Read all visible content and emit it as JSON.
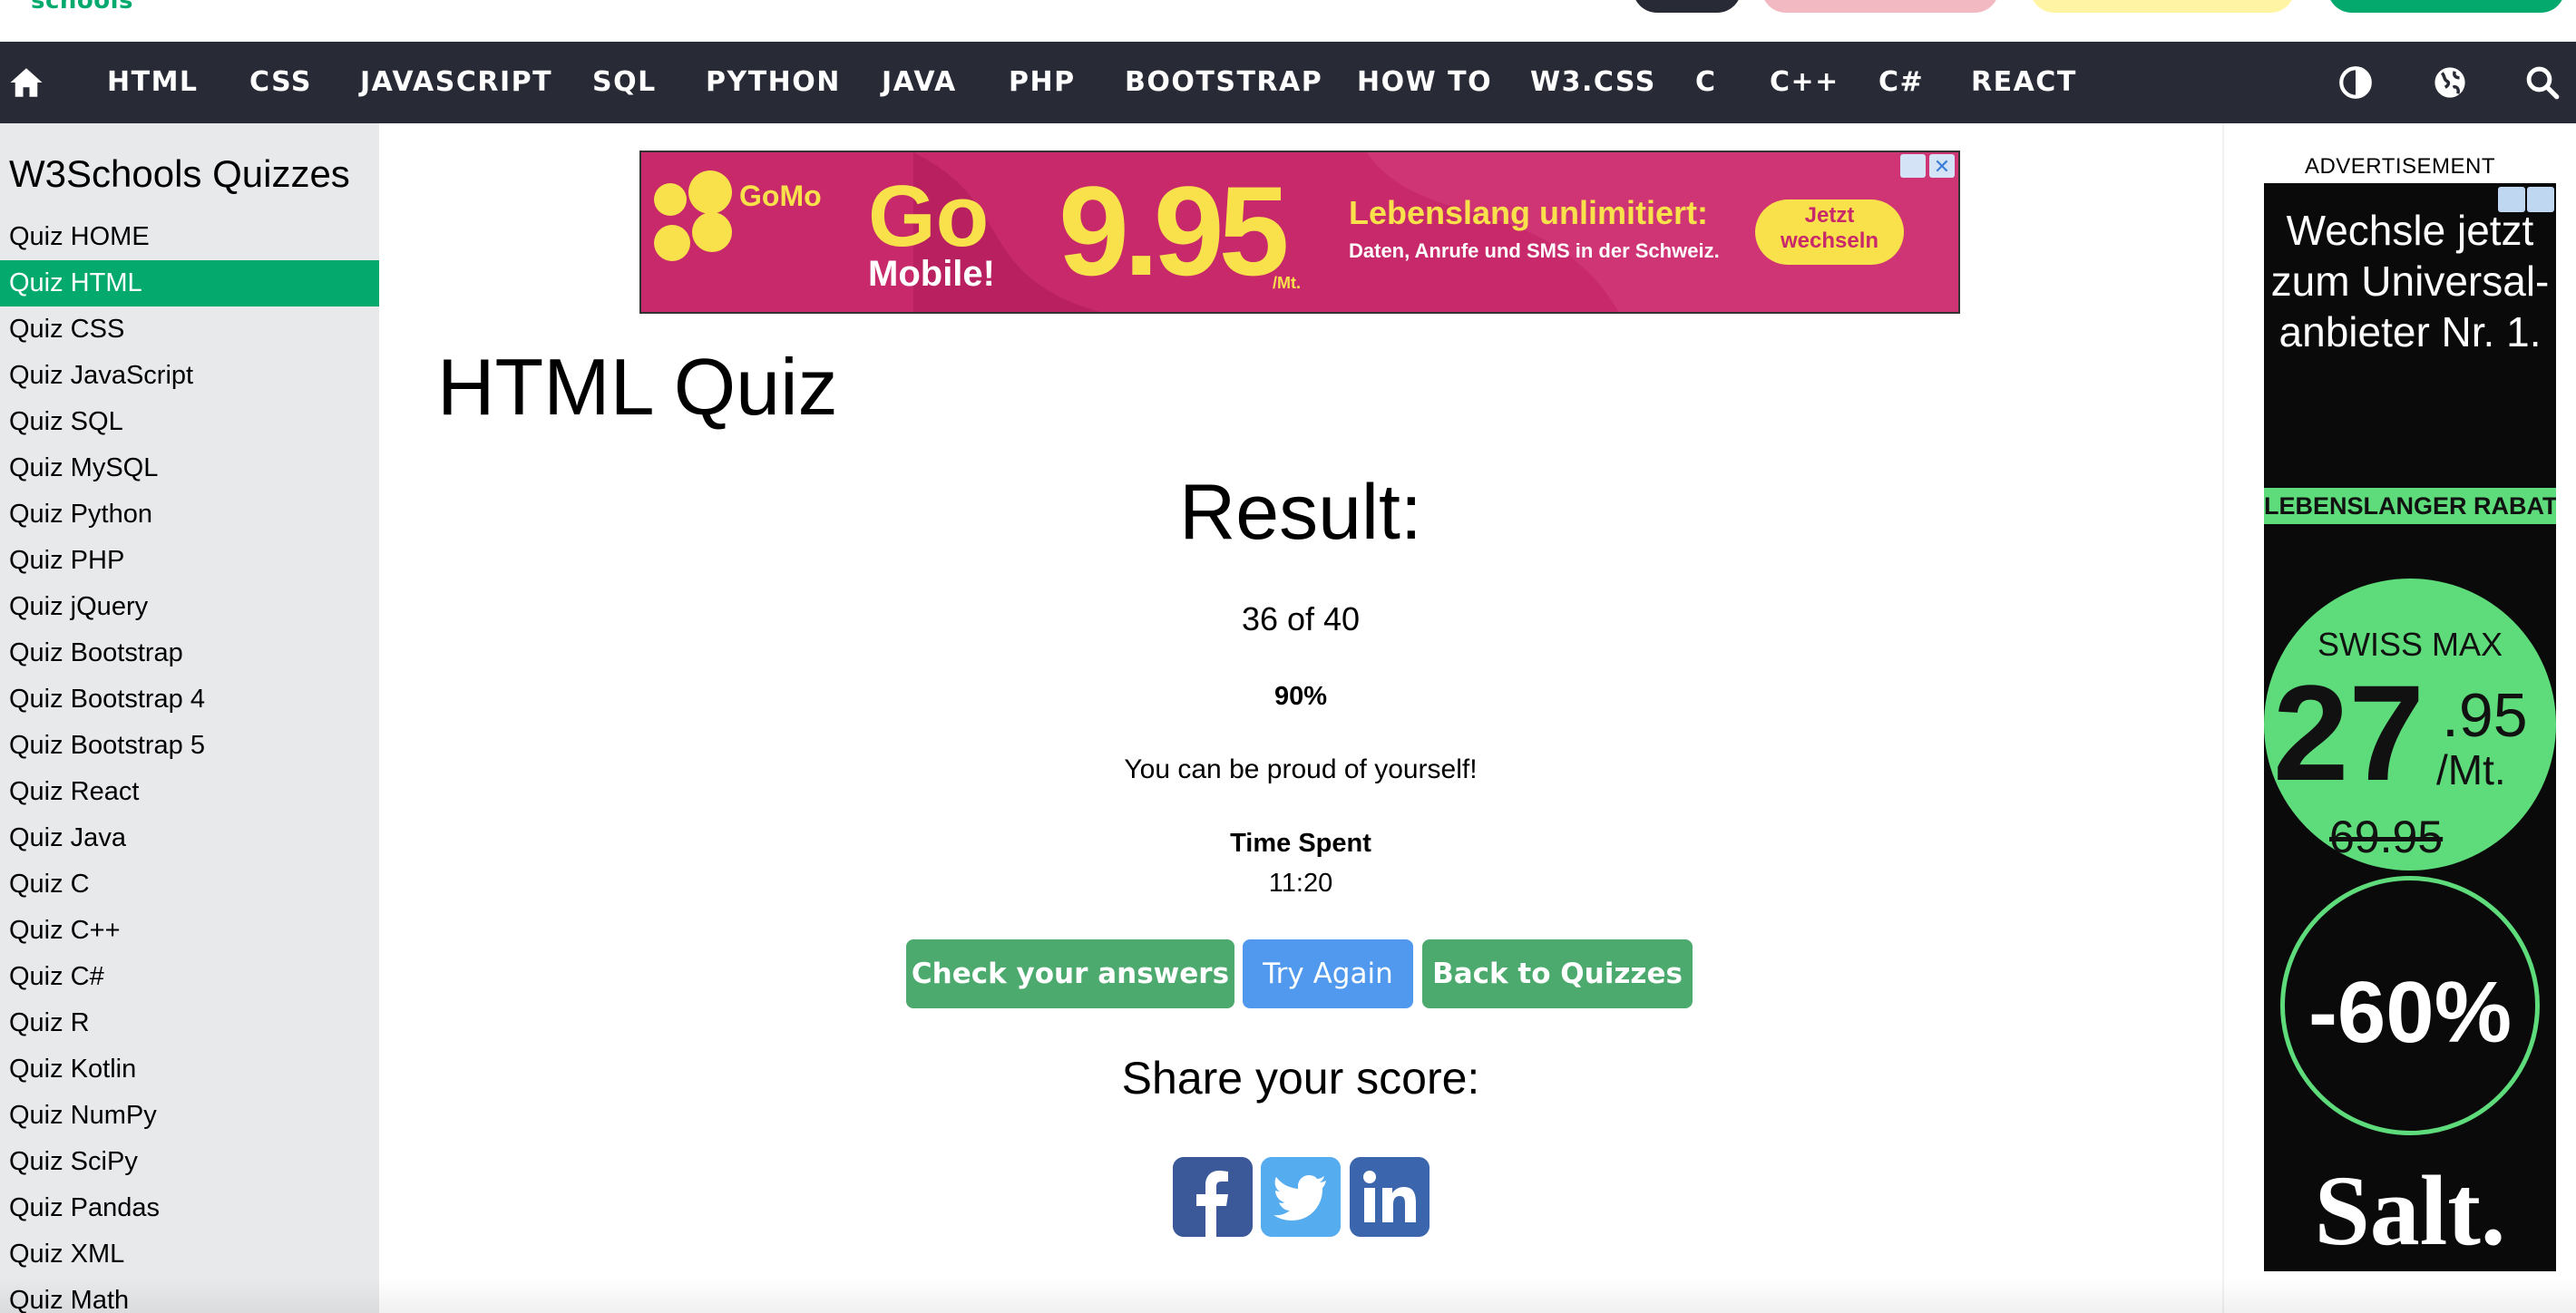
{
  "brand": {
    "logo_fragment": "schools"
  },
  "nav": {
    "items": [
      "HTML",
      "CSS",
      "JAVASCRIPT",
      "SQL",
      "PYTHON",
      "JAVA",
      "PHP",
      "BOOTSTRAP",
      "HOW TO",
      "W3.CSS",
      "C",
      "C++",
      "C#",
      "REACT"
    ],
    "icons": [
      "home-icon",
      "contrast-icon",
      "globe-icon",
      "search-icon"
    ]
  },
  "sidebar": {
    "title": "W3Schools Quizzes",
    "active": "Quiz HTML",
    "items": [
      "Quiz HOME",
      "Quiz HTML",
      "Quiz CSS",
      "Quiz JavaScript",
      "Quiz SQL",
      "Quiz MySQL",
      "Quiz Python",
      "Quiz PHP",
      "Quiz jQuery",
      "Quiz Bootstrap",
      "Quiz Bootstrap 4",
      "Quiz Bootstrap 5",
      "Quiz React",
      "Quiz Java",
      "Quiz C",
      "Quiz C++",
      "Quiz C#",
      "Quiz R",
      "Quiz Kotlin",
      "Quiz NumPy",
      "Quiz SciPy",
      "Quiz Pandas",
      "Quiz XML",
      "Quiz Math"
    ]
  },
  "ad_banner": {
    "brand": "GoMo",
    "go": "Go",
    "mobile": "Mobile!",
    "price": "9.95",
    "price_unit": "/Mt.",
    "headline": "Lebenslang unlimitiert:",
    "subline": "Daten, Anrufe und SMS in der Schweiz.",
    "cta": "Jetzt wechseln"
  },
  "main": {
    "page_title": "HTML Quiz",
    "result_heading": "Result:",
    "score": "36 of 40",
    "percent": "90%",
    "message": "You can be proud of yourself!",
    "time_label": "Time Spent",
    "time_value": "11:20",
    "buttons": {
      "check": "Check your answers",
      "try_again": "Try Again",
      "back": "Back to Quizzes"
    },
    "share_heading": "Share your score:",
    "share_icons": [
      "facebook-icon",
      "twitter-icon",
      "linkedin-icon"
    ]
  },
  "right_ad": {
    "label": "ADVERTISEMENT",
    "headline": "Wechsle jetzt zum Universal-anbieter Nr. 1.",
    "ribbon": "LEBENSLANGER RABATT!",
    "product": "SWISS MAX",
    "price_main": "27",
    "price_cents": ".95",
    "price_unit": "/Mt.",
    "price_old": "69.95",
    "discount": "-60%",
    "brand": "Salt."
  },
  "colors": {
    "nav_bg": "#282A35",
    "sidebar_bg": "#E7E9EB",
    "accent_green": "#04AA6D",
    "button_green": "#4CAA6E",
    "button_blue": "#5199EE",
    "ad_pink": "#C7296B",
    "ad_yellow": "#F9E14B",
    "salt_green": "#5EDB7A"
  }
}
